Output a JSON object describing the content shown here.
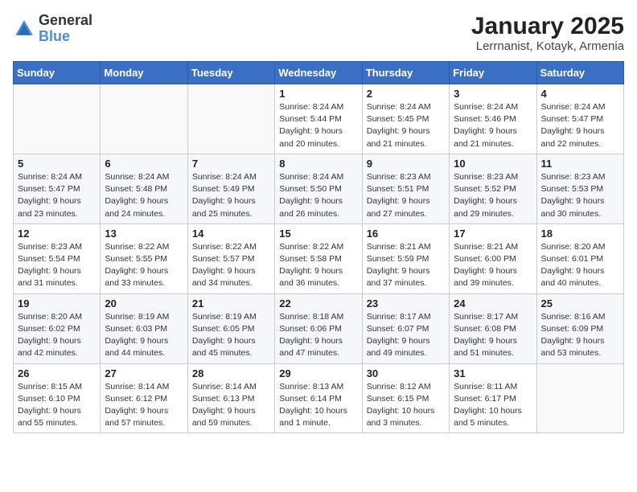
{
  "logo": {
    "general": "General",
    "blue": "Blue"
  },
  "title": "January 2025",
  "subtitle": "Lerrnanist, Kotayk, Armenia",
  "days": [
    "Sunday",
    "Monday",
    "Tuesday",
    "Wednesday",
    "Thursday",
    "Friday",
    "Saturday"
  ],
  "weeks": [
    [
      {
        "date": "",
        "info": ""
      },
      {
        "date": "",
        "info": ""
      },
      {
        "date": "",
        "info": ""
      },
      {
        "date": "1",
        "info": "Sunrise: 8:24 AM\nSunset: 5:44 PM\nDaylight: 9 hours\nand 20 minutes."
      },
      {
        "date": "2",
        "info": "Sunrise: 8:24 AM\nSunset: 5:45 PM\nDaylight: 9 hours\nand 21 minutes."
      },
      {
        "date": "3",
        "info": "Sunrise: 8:24 AM\nSunset: 5:46 PM\nDaylight: 9 hours\nand 21 minutes."
      },
      {
        "date": "4",
        "info": "Sunrise: 8:24 AM\nSunset: 5:47 PM\nDaylight: 9 hours\nand 22 minutes."
      }
    ],
    [
      {
        "date": "5",
        "info": "Sunrise: 8:24 AM\nSunset: 5:47 PM\nDaylight: 9 hours\nand 23 minutes."
      },
      {
        "date": "6",
        "info": "Sunrise: 8:24 AM\nSunset: 5:48 PM\nDaylight: 9 hours\nand 24 minutes."
      },
      {
        "date": "7",
        "info": "Sunrise: 8:24 AM\nSunset: 5:49 PM\nDaylight: 9 hours\nand 25 minutes."
      },
      {
        "date": "8",
        "info": "Sunrise: 8:24 AM\nSunset: 5:50 PM\nDaylight: 9 hours\nand 26 minutes."
      },
      {
        "date": "9",
        "info": "Sunrise: 8:23 AM\nSunset: 5:51 PM\nDaylight: 9 hours\nand 27 minutes."
      },
      {
        "date": "10",
        "info": "Sunrise: 8:23 AM\nSunset: 5:52 PM\nDaylight: 9 hours\nand 29 minutes."
      },
      {
        "date": "11",
        "info": "Sunrise: 8:23 AM\nSunset: 5:53 PM\nDaylight: 9 hours\nand 30 minutes."
      }
    ],
    [
      {
        "date": "12",
        "info": "Sunrise: 8:23 AM\nSunset: 5:54 PM\nDaylight: 9 hours\nand 31 minutes."
      },
      {
        "date": "13",
        "info": "Sunrise: 8:22 AM\nSunset: 5:55 PM\nDaylight: 9 hours\nand 33 minutes."
      },
      {
        "date": "14",
        "info": "Sunrise: 8:22 AM\nSunset: 5:57 PM\nDaylight: 9 hours\nand 34 minutes."
      },
      {
        "date": "15",
        "info": "Sunrise: 8:22 AM\nSunset: 5:58 PM\nDaylight: 9 hours\nand 36 minutes."
      },
      {
        "date": "16",
        "info": "Sunrise: 8:21 AM\nSunset: 5:59 PM\nDaylight: 9 hours\nand 37 minutes."
      },
      {
        "date": "17",
        "info": "Sunrise: 8:21 AM\nSunset: 6:00 PM\nDaylight: 9 hours\nand 39 minutes."
      },
      {
        "date": "18",
        "info": "Sunrise: 8:20 AM\nSunset: 6:01 PM\nDaylight: 9 hours\nand 40 minutes."
      }
    ],
    [
      {
        "date": "19",
        "info": "Sunrise: 8:20 AM\nSunset: 6:02 PM\nDaylight: 9 hours\nand 42 minutes."
      },
      {
        "date": "20",
        "info": "Sunrise: 8:19 AM\nSunset: 6:03 PM\nDaylight: 9 hours\nand 44 minutes."
      },
      {
        "date": "21",
        "info": "Sunrise: 8:19 AM\nSunset: 6:05 PM\nDaylight: 9 hours\nand 45 minutes."
      },
      {
        "date": "22",
        "info": "Sunrise: 8:18 AM\nSunset: 6:06 PM\nDaylight: 9 hours\nand 47 minutes."
      },
      {
        "date": "23",
        "info": "Sunrise: 8:17 AM\nSunset: 6:07 PM\nDaylight: 9 hours\nand 49 minutes."
      },
      {
        "date": "24",
        "info": "Sunrise: 8:17 AM\nSunset: 6:08 PM\nDaylight: 9 hours\nand 51 minutes."
      },
      {
        "date": "25",
        "info": "Sunrise: 8:16 AM\nSunset: 6:09 PM\nDaylight: 9 hours\nand 53 minutes."
      }
    ],
    [
      {
        "date": "26",
        "info": "Sunrise: 8:15 AM\nSunset: 6:10 PM\nDaylight: 9 hours\nand 55 minutes."
      },
      {
        "date": "27",
        "info": "Sunrise: 8:14 AM\nSunset: 6:12 PM\nDaylight: 9 hours\nand 57 minutes."
      },
      {
        "date": "28",
        "info": "Sunrise: 8:14 AM\nSunset: 6:13 PM\nDaylight: 9 hours\nand 59 minutes."
      },
      {
        "date": "29",
        "info": "Sunrise: 8:13 AM\nSunset: 6:14 PM\nDaylight: 10 hours\nand 1 minute."
      },
      {
        "date": "30",
        "info": "Sunrise: 8:12 AM\nSunset: 6:15 PM\nDaylight: 10 hours\nand 3 minutes."
      },
      {
        "date": "31",
        "info": "Sunrise: 8:11 AM\nSunset: 6:17 PM\nDaylight: 10 hours\nand 5 minutes."
      },
      {
        "date": "",
        "info": ""
      }
    ]
  ]
}
